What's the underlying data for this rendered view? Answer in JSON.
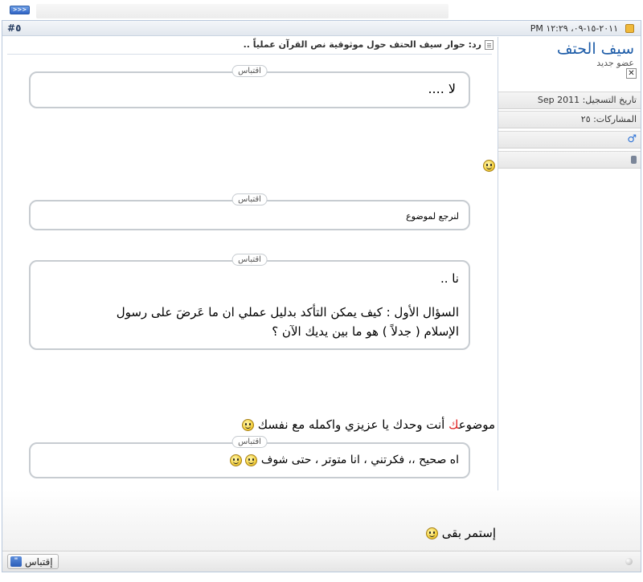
{
  "topbar": {
    "button_label": ">>>"
  },
  "post": {
    "date": "٢٠١١-١٥-٠٩، ١٢:٢٩ PM",
    "number": "#٥",
    "title": "رد: حوار سيف الحتف حول موثوقية نص القرآن عملياً ..",
    "user": {
      "name": "سيف الحتف",
      "title": "عضو جديد",
      "status_icon": "offline-icon",
      "join_date": "تاريخ التسجيل: Sep 2011",
      "posts": "المشاركات: ٢٥",
      "gender_icon": "male-icon",
      "extra_icon": "database-icon"
    },
    "quote_label": "اقتباس",
    "quote1": "لا ....",
    "quote2": "لنرجع لموضوع",
    "quote3_line1": "نا ..",
    "quote3_line2": "السؤال الأول : كيف يمكن التأكد بدليل عملي ان ما عَرضَ على رسول",
    "quote3_line3": "الإسلام ( جدلاً ) هو ما بين يديك الآن ؟",
    "text1_red": "ك",
    "text1_part_a": "موضوع",
    "text1_part_b": " أنت وحدك يا عزيزي واكمله مع نفسك ",
    "quote4": "اه صحيح ،، فكرتني ، انا متوتر ، حتى شوف ",
    "text2": "إستمر بقى ",
    "quote_button": "إقتباس"
  }
}
